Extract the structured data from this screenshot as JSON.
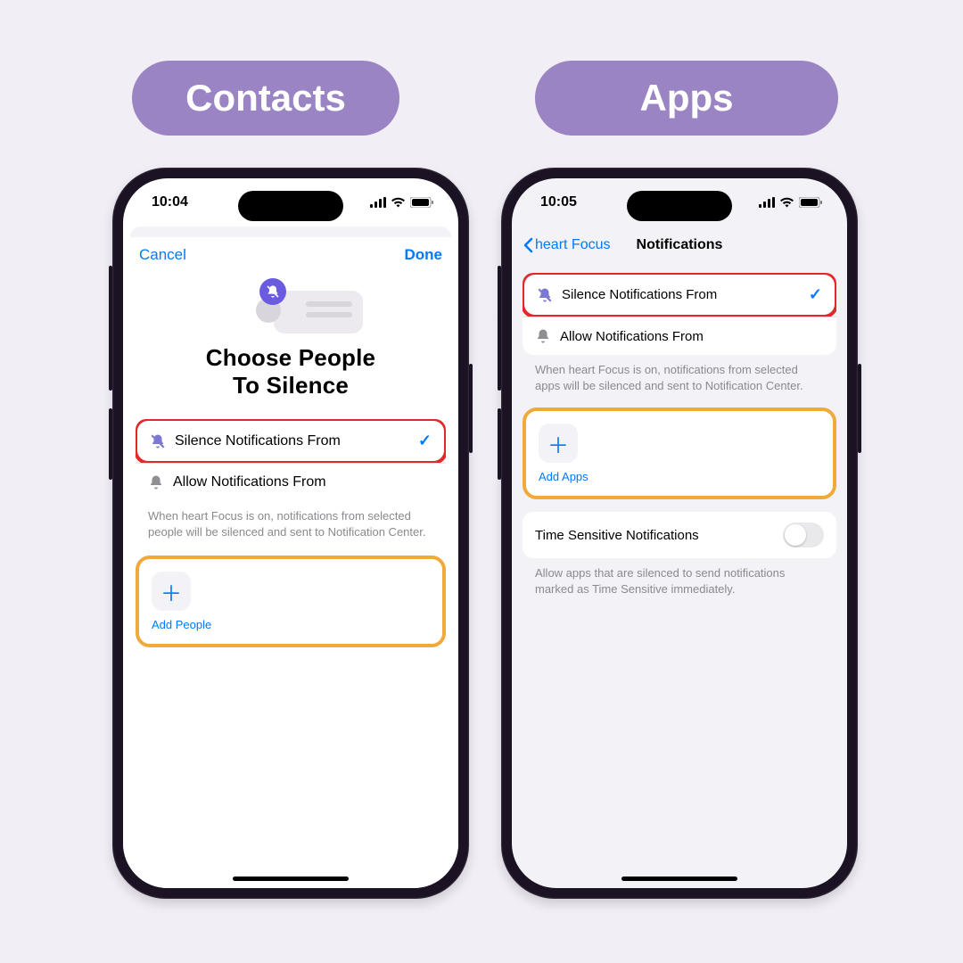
{
  "labels": {
    "contacts": "Contacts",
    "apps": "Apps"
  },
  "left": {
    "time": "10:04",
    "nav": {
      "cancel": "Cancel",
      "done": "Done"
    },
    "title_l1": "Choose People",
    "title_l2": "To Silence",
    "opt_silence": "Silence Notifications From",
    "opt_allow": "Allow Notifications From",
    "caption": "When heart Focus is on, notifications from selected people will be silenced and sent to Notification Center.",
    "add": "Add People"
  },
  "right": {
    "time": "10:05",
    "back": "heart Focus",
    "title": "Notifications",
    "opt_silence": "Silence Notifications From",
    "opt_allow": "Allow Notifications From",
    "caption": "When heart Focus is on, notifications from selected apps will be silenced and sent to Notification Center.",
    "add": "Add Apps",
    "ts_label": "Time Sensitive Notifications",
    "ts_caption": "Allow apps that are silenced to send notifications marked as Time Sensitive immediately."
  }
}
